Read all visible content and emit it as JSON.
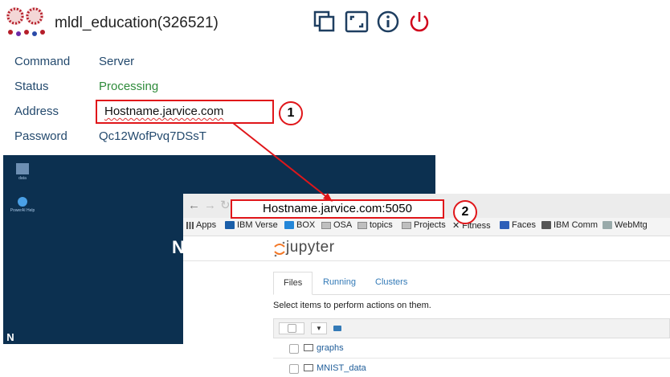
{
  "header": {
    "title": "mldl_education(326521)",
    "logo_icon": "virus-cluster-logo",
    "icons": [
      "copy-icon",
      "fullscreen-icon",
      "info-icon",
      "power-icon"
    ],
    "power_color": "#d0021b"
  },
  "info": {
    "rows": [
      {
        "label": "Command",
        "value": "Server"
      },
      {
        "label": "Status",
        "value": "Processing"
      },
      {
        "label": "Address",
        "value": "Hostname.jarvice.com"
      },
      {
        "label": "Password",
        "value": "Qc12WofPvq7DSsT"
      }
    ],
    "status_color": "#2e8b3a"
  },
  "annotations": {
    "badge1": "1",
    "badge2": "2",
    "box_color": "#e0161a"
  },
  "desktop": {
    "icons": [
      {
        "label": "data"
      },
      {
        "label": "PowerAI Help"
      }
    ],
    "taskbar_logo": "N",
    "overlay_letter": "N"
  },
  "browser": {
    "url": "Hostname.jarvice.com:5050",
    "bookmarks": [
      "Apps",
      "IBM Verse",
      "BOX",
      "OSA",
      "topics",
      "Projects",
      "Fitness",
      "Faces",
      "IBM Comm",
      "WebMtg"
    ],
    "app_name": "jupyter",
    "tabs": [
      "Files",
      "Running",
      "Clusters"
    ],
    "hint": "Select items to perform actions on them.",
    "files": [
      "graphs",
      "MNIST_data"
    ]
  }
}
